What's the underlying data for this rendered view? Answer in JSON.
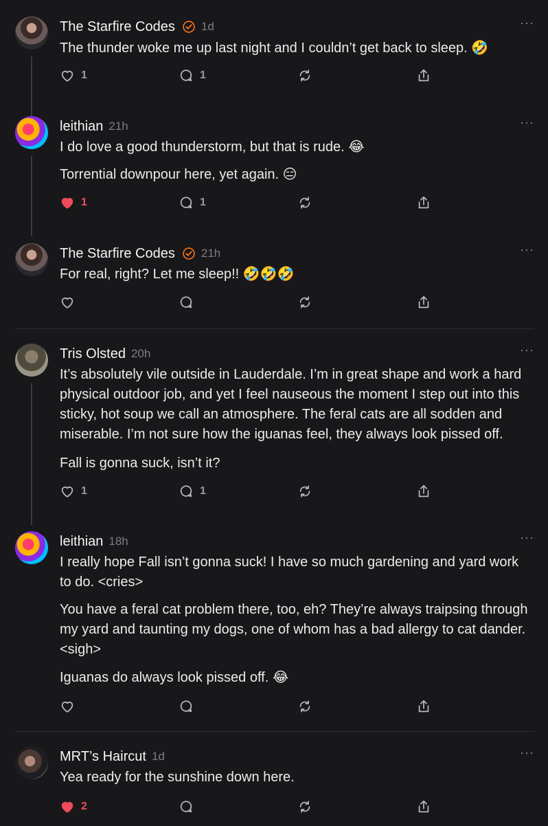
{
  "posts": [
    {
      "author": "The Starfire Codes",
      "verified": true,
      "time": "1d",
      "paragraphs": [
        "The thunder woke me up last night and I couldn’t get back to sleep. 🤣"
      ],
      "likes": "1",
      "liked": false,
      "replies": "1"
    },
    {
      "author": "leithian",
      "verified": false,
      "time": "21h",
      "paragraphs": [
        "I do love a good thunderstorm, but that is rude. 😂",
        "Torrential downpour here, yet again. 😑"
      ],
      "likes": "1",
      "liked": true,
      "replies": "1"
    },
    {
      "author": "The Starfire Codes",
      "verified": true,
      "time": "21h",
      "paragraphs": [
        "For real, right? Let me sleep!! 🤣🤣🤣"
      ],
      "likes": "",
      "liked": false,
      "replies": ""
    },
    {
      "author": "Tris Olsted",
      "verified": false,
      "time": "20h",
      "paragraphs": [
        "It’s absolutely vile outside in Lauderdale. I’m in great shape and work a hard physical outdoor job, and yet I feel nauseous the moment I step out into this sticky, hot soup we call an atmosphere. The feral cats are all sodden and miserable. I’m not sure how the iguanas feel, they always look pissed off.",
        "Fall is gonna suck, isn’t it?"
      ],
      "likes": "1",
      "liked": false,
      "replies": "1"
    },
    {
      "author": "leithian",
      "verified": false,
      "time": "18h",
      "paragraphs": [
        "I really hope Fall isn’t gonna suck! I have so much gardening and yard work to do. <cries>",
        "You have a feral cat problem there, too, eh? They’re always traipsing through my yard and taunting my dogs, one of whom has a bad allergy to cat dander. <sigh>",
        "Iguanas do always look pissed off. 😂"
      ],
      "likes": "",
      "liked": false,
      "replies": ""
    },
    {
      "author": "MRT’s Haircut",
      "verified": false,
      "time": "1d",
      "paragraphs": [
        "Yea ready for the sunshine down here."
      ],
      "likes": "2",
      "liked": true,
      "replies": ""
    }
  ],
  "icons": {
    "more": "more-icon",
    "verified": "verified-badge-icon",
    "like": "heart-icon",
    "reply": "comment-icon",
    "repost": "repost-icon",
    "share": "share-icon"
  },
  "more_glyph": "···",
  "colors": {
    "background": "#18181b",
    "like_active": "#ef4b5b",
    "verified": "#f97316"
  }
}
